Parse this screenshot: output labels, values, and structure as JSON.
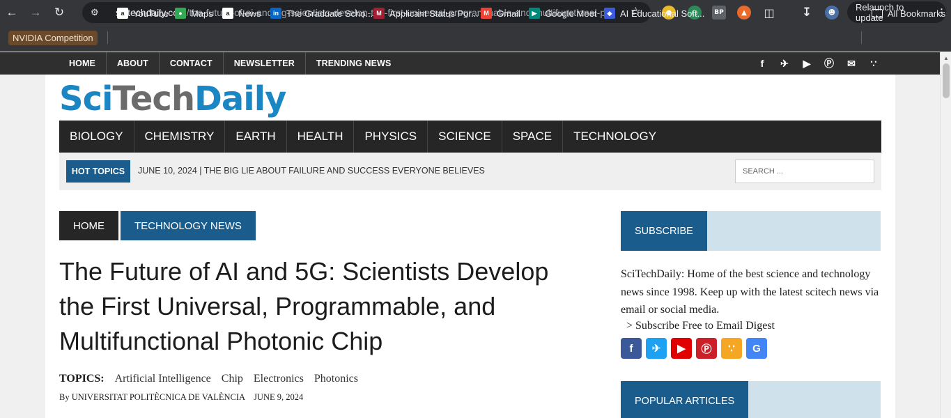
{
  "browser": {
    "url_host": "scitechdaily.com",
    "url_path": "/the-future-of-ai-and-5g-scientists-develop-the-first-universal-programmable-and-multifunctional-p...",
    "relaunch_label": "Relaunch to update",
    "extensions": [
      "BP"
    ],
    "colors": {
      "chrome": "#35363a",
      "omnibox": "#202124"
    }
  },
  "bookmarks": [
    {
      "label": "NVIDIA Competition"
    },
    {
      "label": "YouTube"
    },
    {
      "label": "Maps"
    },
    {
      "label": "News"
    },
    {
      "label": "The Graduate Scho..."
    },
    {
      "label": "Applicant Status Por..."
    },
    {
      "label": "Gmail"
    },
    {
      "label": "Google Meet"
    },
    {
      "label": "AI Educational Soft..."
    },
    {
      "label": "All Bookmarks"
    }
  ],
  "site": {
    "top_nav": [
      "HOME",
      "ABOUT",
      "CONTACT",
      "NEWSLETTER",
      "TRENDING NEWS"
    ],
    "logo": {
      "part1": "Sci",
      "part2": "Tech",
      "part3": "Daily"
    },
    "categories": [
      "BIOLOGY",
      "CHEMISTRY",
      "EARTH",
      "HEALTH",
      "PHYSICS",
      "SCIENCE",
      "SPACE",
      "TECHNOLOGY"
    ],
    "hot_topics": {
      "label": "HOT TOPICS",
      "text": "JUNE 10, 2024  |  THE BIG LIE ABOUT FAILURE AND SUCCESS EVERYONE BELIEVES"
    },
    "search_placeholder": "SEARCH ...",
    "breadcrumbs": {
      "home": "HOME",
      "category": "TECHNOLOGY NEWS"
    },
    "article": {
      "title": "The Future of AI and 5G: Scientists Develop the First Universal, Programmable, and Multifunctional Photonic Chip",
      "topics_label": "TOPICS:",
      "topics": [
        "Artificial Intelligence",
        "Chip",
        "Electronics",
        "Photonics"
      ],
      "byline": "By UNIVERSITAT POLITÈCNICA DE VALÈNCIA",
      "date": "JUNE 9, 2024"
    },
    "sidebar": {
      "subscribe_label": "SUBSCRIBE",
      "subscribe_text": "SciTechDaily: Home of the best science and technology news since 1998. Keep up with the latest scitech news via email or social media.",
      "subscribe_link": "> Subscribe Free to Email Digest",
      "popular_label": "POPULAR ARTICLES"
    },
    "colors": {
      "accent": "#1a5d8c",
      "logo_blue": "#1a86c4",
      "logo_gray": "#6b6b6b",
      "dark_nav": "#262626"
    }
  }
}
